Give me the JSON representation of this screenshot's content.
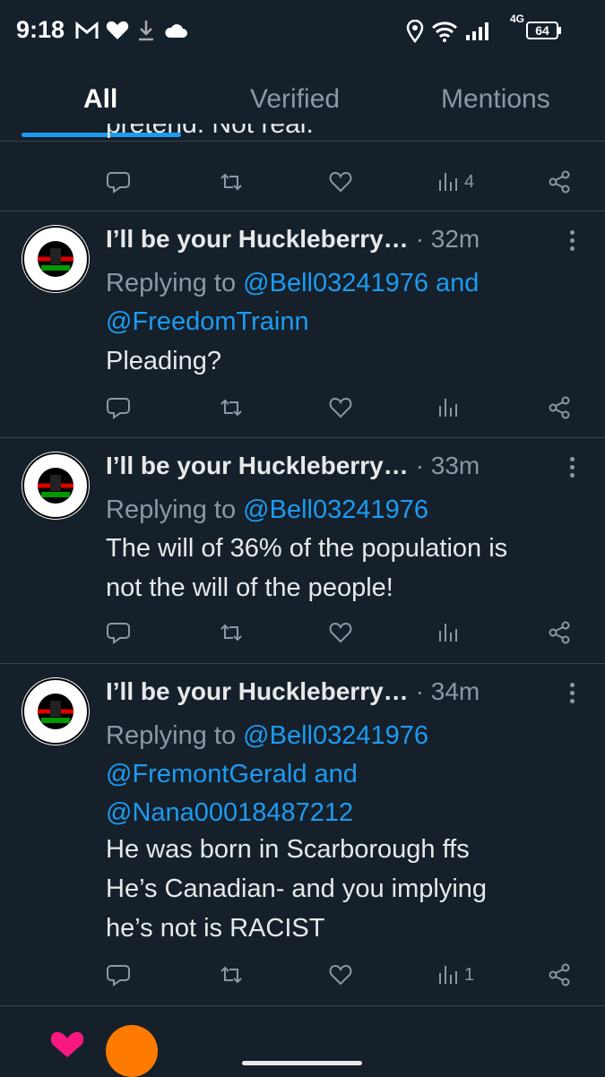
{
  "status_bar": {
    "time": "9:18",
    "network": "4G",
    "battery": "64"
  },
  "tabs": [
    {
      "label": "All",
      "active": true
    },
    {
      "label": "Verified",
      "active": false
    },
    {
      "label": "Mentions",
      "active": false
    }
  ],
  "previous_tweet": {
    "clipped_text": "pretend. Not real.",
    "views": "4"
  },
  "tweets": [
    {
      "author": "I’ll be your Huckleberry…",
      "time": "· 32m",
      "replying_prefix": "Replying to",
      "mention1": "@Bell03241976",
      "joiner": "and",
      "mention2": "@FreedomTrainn",
      "mention3": "",
      "body": "Pleading?",
      "views": ""
    },
    {
      "author": "I’ll be your Huckleberry…",
      "time": "· 33m",
      "replying_prefix": "Replying to",
      "mention1": "@Bell03241976",
      "body_line1": "The will of 36% of the population is",
      "body_line2": "not the will of the people!",
      "views": ""
    },
    {
      "author": "I’ll be your Huckleberry…",
      "time": "· 34m",
      "replying_prefix": "Replying to",
      "mention1": "@Bell03241976",
      "mention2": "@FremontGerald",
      "joiner": "and",
      "mention3": "@Nana00018487212",
      "body_line1": "He was born in Scarborough ffs",
      "body_line2": "He’s Canadian- and you implying",
      "body_line3": "he’s not is RACIST",
      "views": "1"
    }
  ],
  "colors": {
    "background": "#15202b",
    "accent": "#1d9bf0",
    "muted": "#8b98a5",
    "text": "#e7e9ea"
  },
  "icons": [
    "gmail-icon",
    "heart-icon",
    "download-icon",
    "cloud-icon",
    "location-icon",
    "wifi-icon",
    "signal-icon",
    "battery-icon",
    "reply-icon",
    "retweet-icon",
    "like-icon",
    "views-icon",
    "share-icon",
    "more-icon"
  ]
}
